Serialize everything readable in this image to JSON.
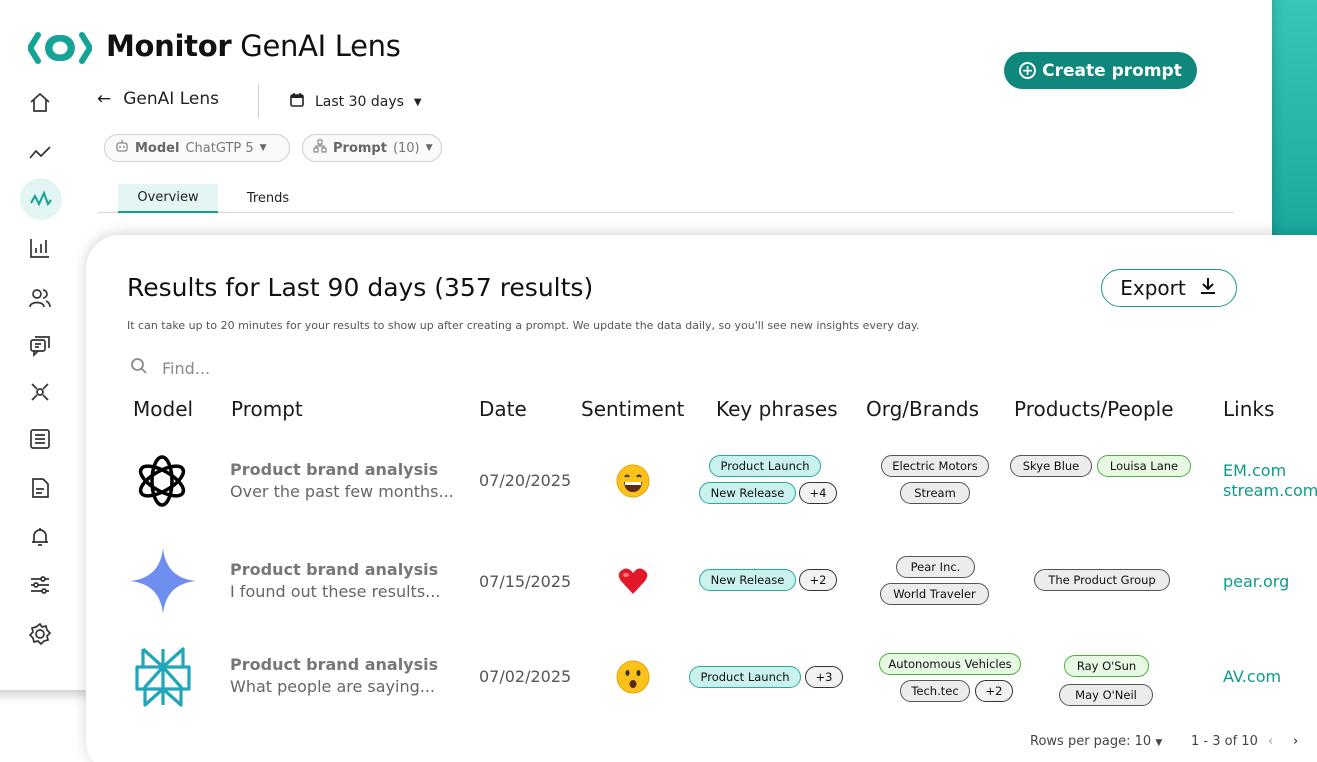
{
  "app": {
    "brand_bold": "Monitor",
    "brand_light": "GenAI Lens"
  },
  "header": {
    "create_label": "Create prompt",
    "back_label": "GenAI Lens",
    "date_range": "Last 30 days"
  },
  "filters": {
    "model_label": "Model",
    "model_value": "ChatGTP 5",
    "prompt_label": "Prompt",
    "prompt_count": "(10)"
  },
  "tabs": [
    {
      "label": "Overview",
      "active": true
    },
    {
      "label": "Trends",
      "active": false
    }
  ],
  "sidebar": {
    "items": [
      "home-icon",
      "trend-line-icon",
      "pulse-icon",
      "bar-chart-icon",
      "users-icon",
      "chat-icon",
      "network-icon",
      "list-icon",
      "document-icon",
      "bell-icon",
      "sliders-icon",
      "settings-icon"
    ],
    "active_index": 2
  },
  "results": {
    "title": "Results for Last 90 days (357 results)",
    "notice": "It can take up to 20 minutes for your results to show up after creating a prompt. We update the data daily, so you'll see new insights every day.",
    "export_label": "Export",
    "search_placeholder": "Find..."
  },
  "table": {
    "columns": [
      "Model",
      "Prompt",
      "Date",
      "Sentiment",
      "Key phrases",
      "Org/Brands",
      "Products/People",
      "Links"
    ],
    "rows": [
      {
        "model_icon": "openai-logo-icon",
        "prompt_title": "Product brand analysis",
        "prompt_excerpt": "Over the past few months...",
        "date": "07/20/2025",
        "sentiment": "grinning-face",
        "key_phrases": [
          "Product Launch",
          "New Release",
          "+4"
        ],
        "orgs": [
          "Electric Motors",
          "Stream"
        ],
        "people": [
          "Skye Blue",
          "Louisa Lane"
        ],
        "links": [
          "EM.com",
          "stream.com"
        ]
      },
      {
        "model_icon": "sparkle-star-logo-icon",
        "prompt_title": "Product brand analysis",
        "prompt_excerpt": "I found out these results...",
        "date": "07/15/2025",
        "sentiment": "red-heart",
        "key_phrases": [
          "New Release",
          "+2"
        ],
        "orgs": [
          "Pear Inc.",
          "World Traveler"
        ],
        "people": [
          "The Product Group"
        ],
        "links": [
          "pear.org"
        ]
      },
      {
        "model_icon": "perplexity-logo-icon",
        "prompt_title": "Product brand analysis",
        "prompt_excerpt": "What people are saying...",
        "date": "07/02/2025",
        "sentiment": "surprised-face",
        "key_phrases": [
          "Product Launch",
          "+3"
        ],
        "orgs": [
          "Autonomous Vehicles",
          "Tech.tec",
          "+2"
        ],
        "people": [
          "Ray O'Sun",
          "May O'Neil"
        ],
        "links": [
          "AV.com"
        ]
      }
    ]
  },
  "pagination": {
    "rows_per_page": "Rows per page: 10",
    "range": "1 - 3 of 10"
  },
  "colors": {
    "accent": "#10877c",
    "accent_light": "#c9f1ee",
    "teal_strip": "#1fb3a5"
  }
}
